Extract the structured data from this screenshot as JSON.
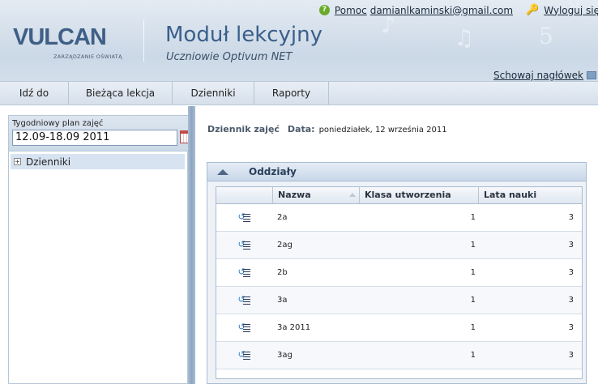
{
  "header": {
    "logo_text": "VULCAN",
    "logo_subtitle": "ZARZĄDZANIE OŚWIATĄ",
    "module_title": "Moduł lekcyjny",
    "module_subtitle": "Uczniowie Optivum NET",
    "help_label": "Pomoc",
    "user_email": "damianlkaminski@gmail.com",
    "logout_label": "Wyloguj się",
    "hide_header_label": "Schowaj nagłówek",
    "deco_glyphs": [
      "♪",
      "♫",
      "5",
      "8"
    ]
  },
  "menu": {
    "items": [
      {
        "label": "Idź do"
      },
      {
        "label": "Bieżąca lekcja"
      },
      {
        "label": "Dzienniki"
      },
      {
        "label": "Raporty"
      }
    ]
  },
  "left": {
    "week_label": "Tygodniowy plan zajęć",
    "week_value": "12.09-18.09 2011",
    "tree_item": "Dzienniki"
  },
  "main": {
    "section_label": "Dziennik zajęć",
    "date_label": "Data:",
    "date_value": "poniedziałek, 12 września 2011",
    "panel_title": "Oddziały",
    "columns": [
      "Nazwa",
      "Klasa utworzenia",
      "Lata nauki"
    ],
    "rows": [
      {
        "name": "2a",
        "klasa": "1",
        "lata": "3"
      },
      {
        "name": "2ag",
        "klasa": "1",
        "lata": "3"
      },
      {
        "name": "2b",
        "klasa": "1",
        "lata": "3"
      },
      {
        "name": "3a",
        "klasa": "1",
        "lata": "3"
      },
      {
        "name": "3a 2011",
        "klasa": "1",
        "lata": "3"
      },
      {
        "name": "3ag",
        "klasa": "1",
        "lata": "3"
      }
    ]
  },
  "colors": {
    "accent": "#3a5f8a",
    "header_bg": "#cbd8e6",
    "selected_row": "#d7e3f1"
  }
}
